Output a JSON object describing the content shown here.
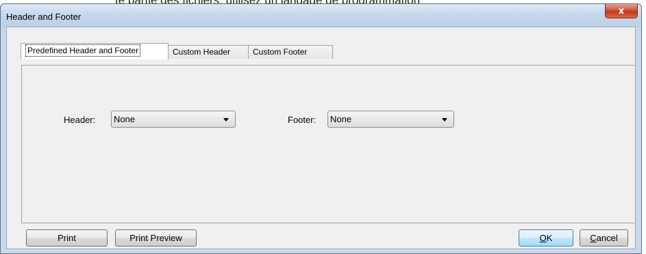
{
  "background_text": "te partie des fichiers, utilisez un langage de programmation",
  "window": {
    "title": "Header and Footer",
    "close_glyph": "x"
  },
  "tabs": [
    {
      "label": "Predefined Header and Footer",
      "active": true
    },
    {
      "label": "Custom Header",
      "active": false
    },
    {
      "label": "Custom Footer",
      "active": false
    }
  ],
  "header_field": {
    "label": "Header:",
    "value": "None"
  },
  "footer_field": {
    "label": "Footer:",
    "value": "None"
  },
  "buttons": {
    "print": "Print",
    "print_preview": "Print Preview",
    "ok_mnemonic": "O",
    "ok_rest": "K",
    "cancel_mnemonic": "C",
    "cancel_rest": "ancel"
  },
  "colors": {
    "accent": "#3c7fb1",
    "close_button": "#c0391f"
  }
}
